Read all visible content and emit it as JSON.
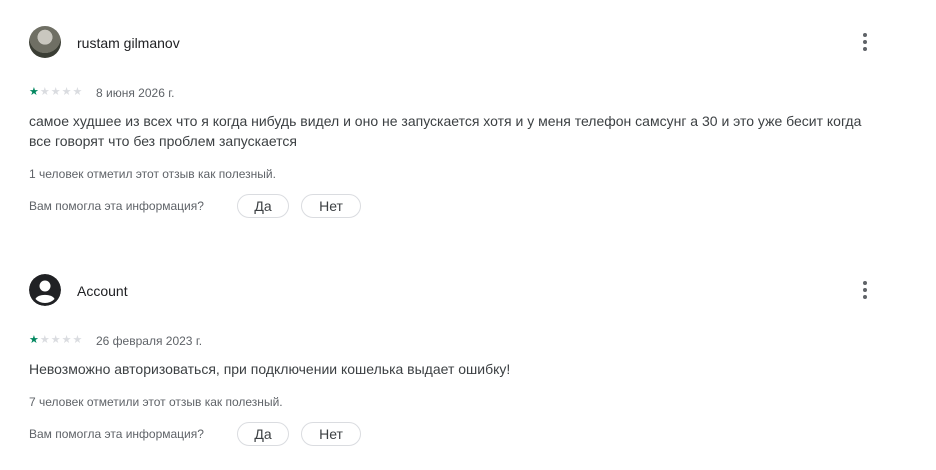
{
  "reviews": [
    {
      "author": "rustam gilmanov",
      "rating": 1,
      "max_rating": 5,
      "date": "8 июня 2026 г.",
      "text": "самое худшее из всех что я когда нибудь видел и оно не запускается хотя и у меня телефон самсунг а 30 и это уже бесит когда все говорят что без проблем запускается",
      "helpful_count_text": "1 человек отметил этот отзыв как полезный.",
      "helpful_question": "Вам помогла эта информация?",
      "yes_label": "Да",
      "no_label": "Нет",
      "avatar_icon": "user-photo-avatar",
      "menu_icon": "more-vert-icon"
    },
    {
      "author": "Account",
      "rating": 1,
      "max_rating": 5,
      "date": "26 февраля 2023 г.",
      "text": "Невозможно авторизоваться, при подключении кошелька выдает ошибку!",
      "helpful_count_text": "7 человек отметили этот отзыв как полезный.",
      "helpful_question": "Вам помогла эта информация?",
      "yes_label": "Да",
      "no_label": "Нет",
      "avatar_icon": "account-circle-icon",
      "menu_icon": "more-vert-icon"
    }
  ],
  "colors": {
    "star_filled": "#01875f",
    "star_empty": "#dadce0",
    "secondary_text": "#5f6368"
  }
}
